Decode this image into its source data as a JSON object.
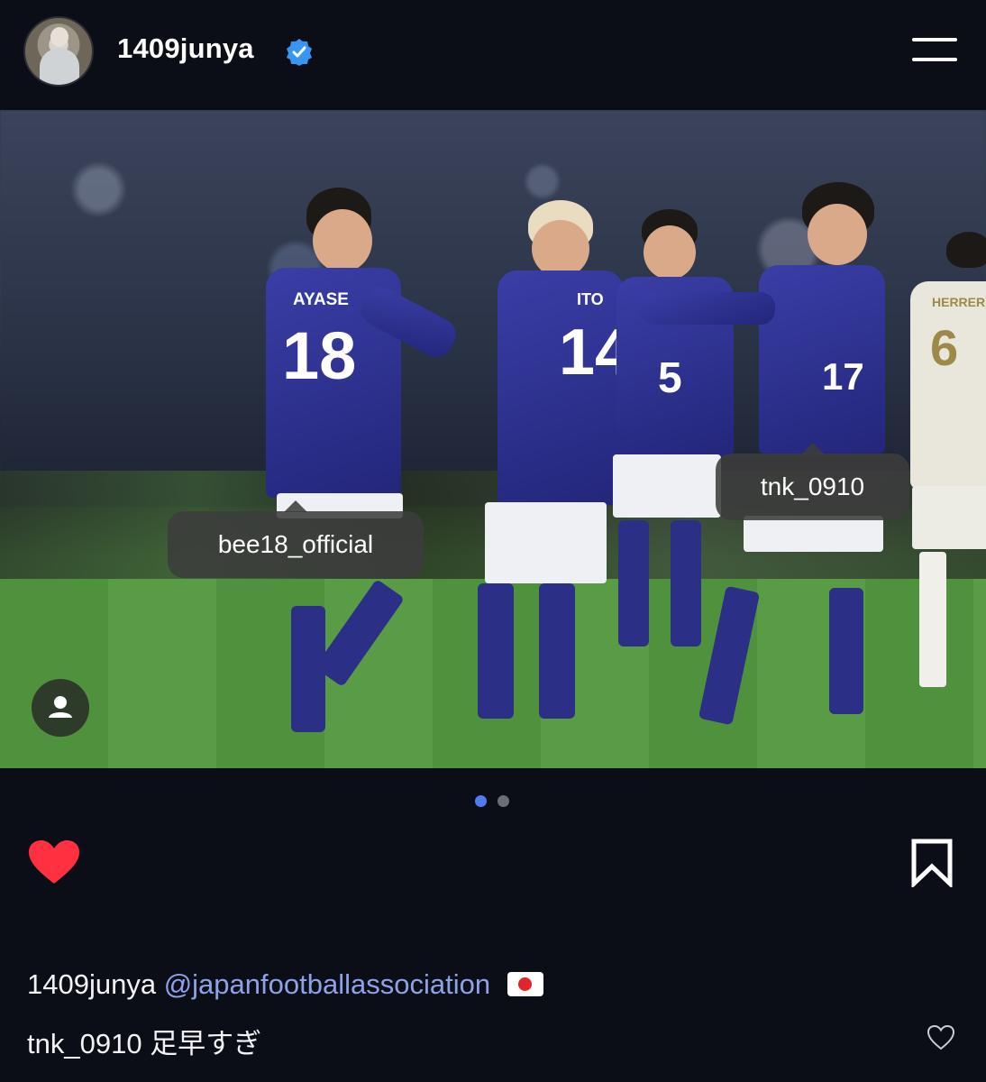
{
  "header": {
    "username": "1409junya",
    "verified": true,
    "menu_icon": "hamburger-menu-icon"
  },
  "post": {
    "photo_tags": [
      {
        "label": "bee18_official"
      },
      {
        "label": "tnk_0910"
      }
    ],
    "jerseys": {
      "player_a": {
        "name": "AYASE",
        "number": "18"
      },
      "player_b": {
        "name": "ITO",
        "number": "14"
      },
      "player_c": {
        "number": "5"
      },
      "player_d": {
        "number": "17"
      },
      "opponent": {
        "name": "HERRERA",
        "number": "6"
      }
    },
    "carousel": {
      "total": 2,
      "active": 1
    },
    "liked": true,
    "colors": {
      "heart": "#ff3040",
      "active_dot": "#4f7cf0",
      "inactive_dot": "#6b6e75",
      "mention": "#8fa2e8"
    }
  },
  "caption": {
    "username": "1409junya",
    "mention": "@japanfootballassociation",
    "emoji": "🇯🇵"
  },
  "comment": {
    "username": "tnk_0910",
    "text": "足早すぎ"
  }
}
